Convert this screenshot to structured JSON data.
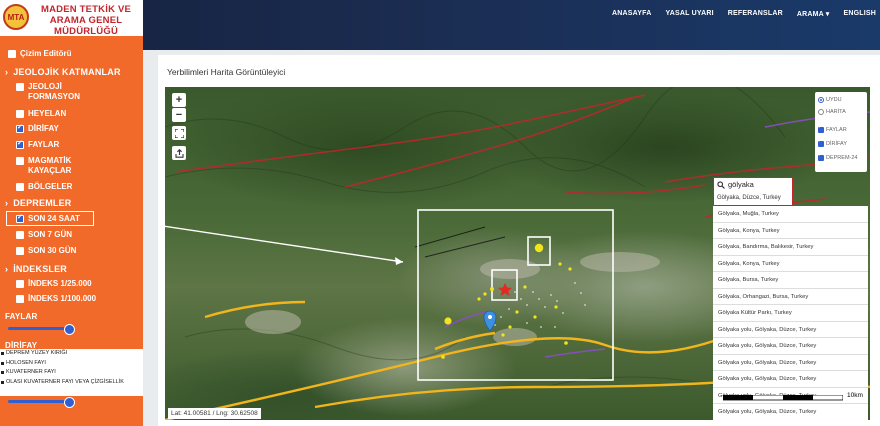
{
  "header": {
    "logo_mark": "MTA",
    "org_name": "MADEN TETKİK VE ARAMA GENEL MÜDÜRLÜĞÜ",
    "nav": [
      "ANASAYFA",
      "YASAL UYARI",
      "REFERANSLAR",
      "ARAMA ▾",
      "ENGLISH"
    ]
  },
  "sidebar": {
    "drawing_editor": {
      "label": "Çizim Editörü",
      "checked": false
    },
    "sections": [
      {
        "title": "JEOLOJİK KATMANLAR"
      },
      {
        "title": "DEPREMLER"
      },
      {
        "title": "İNDEKSLER"
      }
    ],
    "geology_items": [
      {
        "label": "JEOLOJİ FORMASYON",
        "checked": false
      },
      {
        "label": "HEYELAN",
        "checked": false
      },
      {
        "label": "DİRİFAY",
        "checked": true
      },
      {
        "label": "FAYLAR",
        "checked": true
      },
      {
        "label": "MAGMATİK KAYAÇLAR",
        "checked": false
      },
      {
        "label": "BÖLGELER",
        "checked": false
      }
    ],
    "earthquake_items": [
      {
        "label": "SON 24 SAAT",
        "checked": true
      },
      {
        "label": "SON 7 GÜN",
        "checked": false
      },
      {
        "label": "SON 30 GÜN",
        "checked": false
      }
    ],
    "index_items": [
      {
        "label": "İNDEKS 1/25.000",
        "checked": false
      },
      {
        "label": "İNDEKS 1/100.000",
        "checked": false
      }
    ],
    "slider_labels": [
      "FAYLAR",
      "DİRİFAY"
    ],
    "legend": [
      "DEPREM YÜZEY KIRIĞI",
      "HOLOSEN FAYI",
      "KUVATERNER FAYI",
      "OLASI KUVATERNER FAYI VEYA ÇİZGİSELLİK"
    ]
  },
  "panel": {
    "title": "Yerbilimleri Harita Görüntüleyici"
  },
  "map": {
    "zoom_in": "+",
    "zoom_out": "−",
    "layer_panel": {
      "base": [
        {
          "label": "UYDU",
          "selected": true
        },
        {
          "label": "HARİTA",
          "selected": false
        }
      ],
      "overlays": [
        {
          "label": "FAYLAR",
          "checked": true
        },
        {
          "label": "DİRİFAY",
          "checked": true
        },
        {
          "label": "DEPREM-24",
          "checked": true
        }
      ]
    },
    "search": {
      "value": "gölyaka",
      "first_suggestion": "Gölyaka, Düzce, Turkey",
      "suggestions": [
        "Gölyaka, Muğla, Turkey",
        "Gölyaka, Konya, Turkey",
        "Gölyaka, Bandırma, Balıkesir, Turkey",
        "Gölyaka, Konya, Turkey",
        "Gölyaka, Bursa, Turkey",
        "Gölyaka, Orhangazi, Bursa, Turkey",
        "Gölyaka Kültür Parkı, Turkey",
        "Gölyaka yolu, Gölyaka, Düzce, Turkey",
        "Gölyaka yolu, Gölyaka, Düzce, Turkey",
        "Gölyaka yolu, Gölyaka, Düzce, Turkey",
        "Gölyaka yolu, Gölyaka, Düzce, Turkey",
        "Gölyaka yolu, Gölyaka, Düzce, Turkey",
        "Gölyaka yolu, Gölyaka, Düzce, Turkey"
      ]
    },
    "coords": "Lat: 41.00581 / Lng: 30.62508",
    "scale_label": "10km",
    "colors": {
      "fault_red": "#c0262c",
      "fault_yellow": "#f2b51c",
      "fault_purple": "#8a4fc6",
      "quake": "#f2e41c",
      "marker": "#3d8fe0"
    }
  }
}
